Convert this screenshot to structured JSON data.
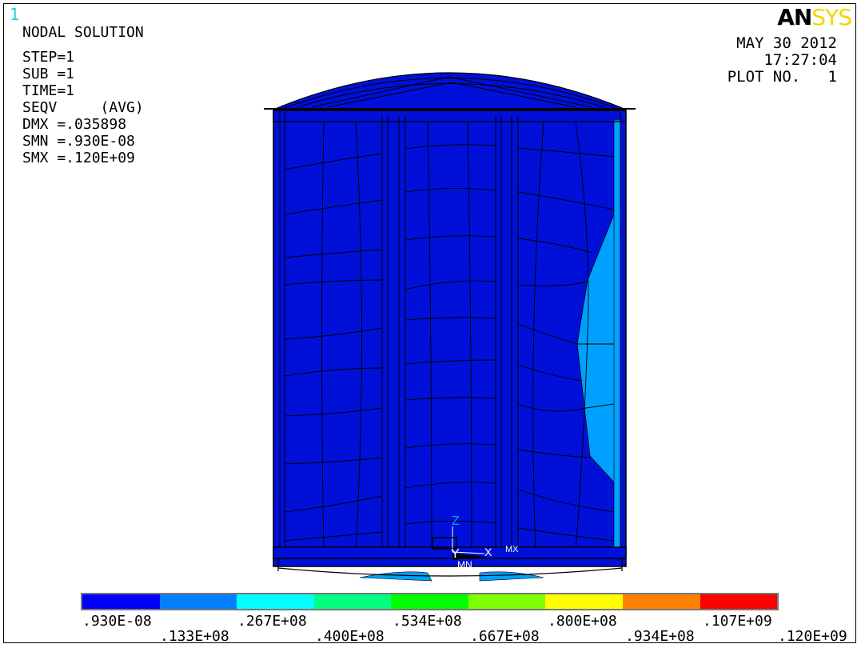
{
  "window_number": "1",
  "info": {
    "title": "NODAL SOLUTION",
    "step": "STEP=1",
    "sub": "SUB =1",
    "time": "TIME=1",
    "seqv": "SEQV     (AVG)",
    "dmx": "DMX =.035898",
    "smn": "SMN =.930E-08",
    "smx": "SMX =.120E+09"
  },
  "logo": {
    "part1": "AN",
    "part2": "SYS"
  },
  "header": {
    "date": "MAY 30 2012",
    "time": "17:27:04",
    "plot": "PLOT NO.   1"
  },
  "triad": {
    "z": "Z",
    "y": "Y",
    "x": "X",
    "mn": "MN",
    "mx": "MX"
  },
  "legend": {
    "colors": [
      "#0000ff",
      "#0080ff",
      "#00ffff",
      "#00ff80",
      "#00ff00",
      "#80ff00",
      "#ffff00",
      "#ff8000",
      "#ff0000"
    ],
    "top_labels": [
      ".930E-08",
      ".267E+08",
      ".534E+08",
      ".800E+08",
      ".107E+09"
    ],
    "bottom_labels": [
      ".133E+08",
      ".400E+08",
      ".667E+08",
      ".934E+08",
      ".120E+09"
    ]
  },
  "colors": {
    "model_dark": "#0010d8",
    "model_light": "#00a0ff"
  }
}
